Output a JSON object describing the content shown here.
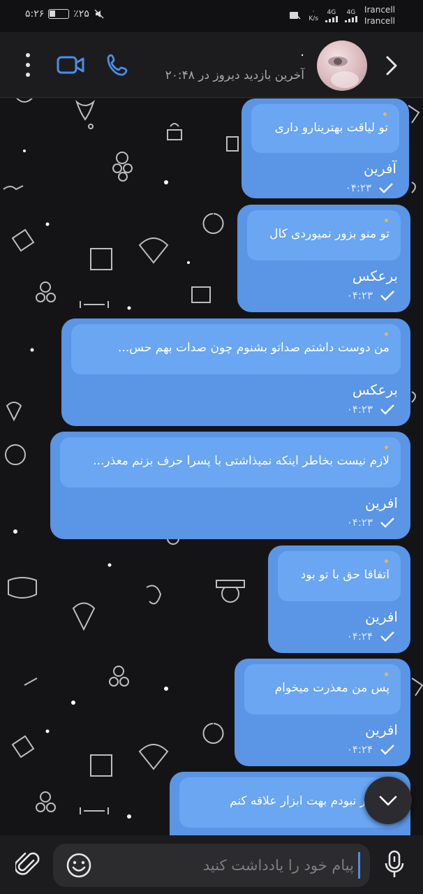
{
  "status_bar": {
    "time": "۵:۲۶",
    "battery": "٪۲۵",
    "carrier_1": "Irancell",
    "carrier_2": "Irancell",
    "net_speed": "K/s",
    "net_type_1": "4G",
    "net_type_2": "4G"
  },
  "header": {
    "contact_name": ".",
    "last_seen": "آخرین بازدید دیروز در ۲۰:۴۸",
    "icons": [
      "menu-dots-icon",
      "video-call-icon",
      "phone-icon",
      "back-chevron-icon"
    ],
    "accent_color": "#4a8fe8"
  },
  "messages": [
    {
      "reply_preview": "تو لیاقت بهترینارو داری",
      "text": "آفرین",
      "time": "۰۴:۲۳"
    },
    {
      "reply_preview": "تو منو بزور نمیوردی کال",
      "text": "برعکس",
      "time": "۰۴:۲۳"
    },
    {
      "reply_preview": "من دوست داشتم صداتو بشنوم چون صدات بهم حس...",
      "text": "برعکس",
      "time": "۰۴:۲۳"
    },
    {
      "reply_preview": "لازم نیست بخاطر اینکه نمیذاشتی با پسرا حرف بزنم معذر...",
      "text": "افرین",
      "time": "۰۴:۲۳"
    },
    {
      "reply_preview": "اتفاقا حق با تو بود",
      "text": "افرین",
      "time": "۰۴:۲۴"
    },
    {
      "reply_preview": "پس من معذرت میخوام",
      "text": "افرین",
      "time": "۰۴:۲۴"
    },
    {
      "reply_preview": "مجبور نبودم بهت ابزار علاقه کنم",
      "text": "",
      "time": ""
    }
  ],
  "bubble_color": "#5a95e6",
  "reply_color": "#6aa6f2",
  "composer": {
    "placeholder": "پیام خود را یادداشت کنید"
  }
}
